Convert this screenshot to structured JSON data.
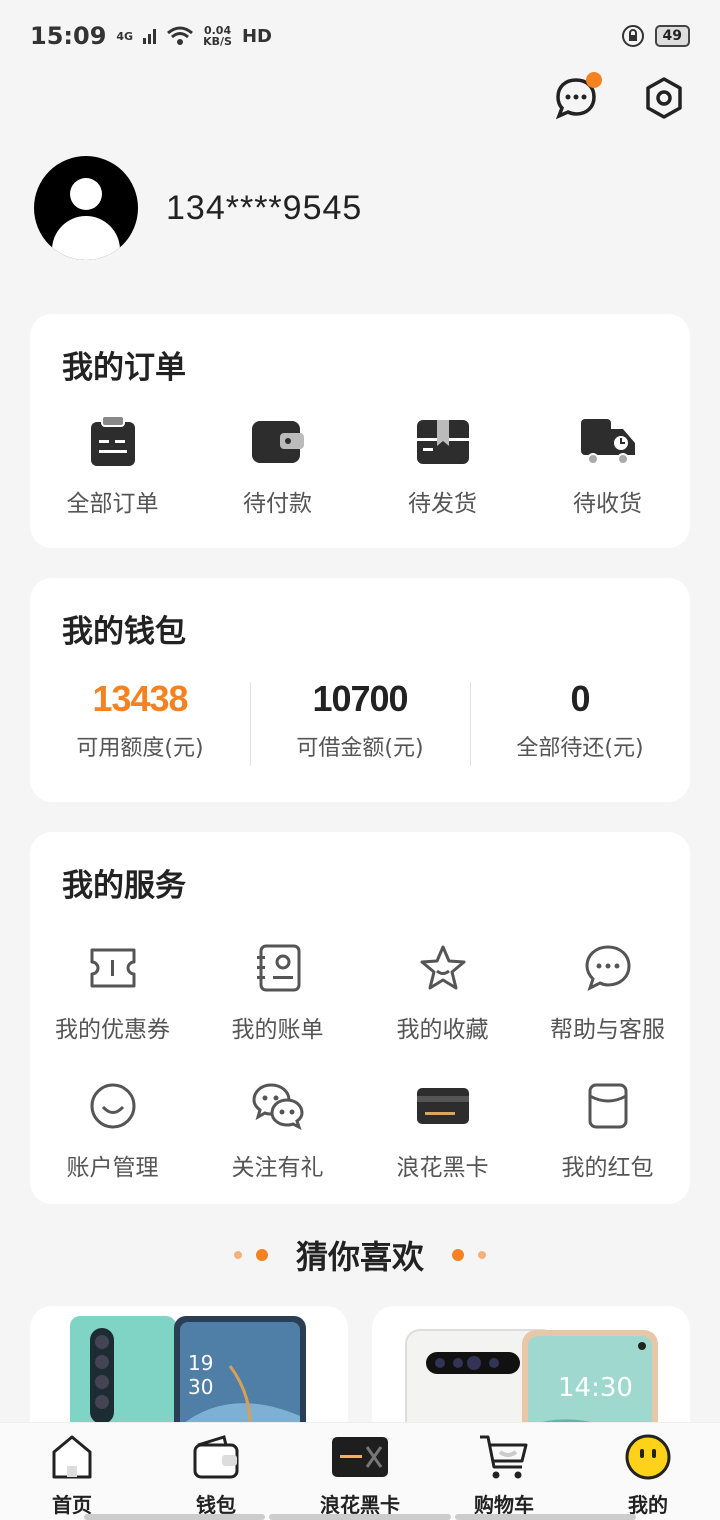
{
  "status_bar": {
    "time": "15:09",
    "network": "4G",
    "speed_value": "0.04",
    "speed_unit": "KB/S",
    "hd": "HD",
    "battery": "49"
  },
  "profile": {
    "phone": "134****9545"
  },
  "orders": {
    "title": "我的订单",
    "items": [
      {
        "label": "全部订单",
        "icon": "clipboard-icon"
      },
      {
        "label": "待付款",
        "icon": "wallet-icon"
      },
      {
        "label": "待发货",
        "icon": "box-icon"
      },
      {
        "label": "待收货",
        "icon": "truck-icon"
      }
    ]
  },
  "wallet": {
    "title": "我的钱包",
    "items": [
      {
        "value": "13438",
        "label": "可用额度(元)"
      },
      {
        "value": "10700",
        "label": "可借金额(元)"
      },
      {
        "value": "0",
        "label": "全部待还(元)"
      }
    ]
  },
  "services": {
    "title": "我的服务",
    "items": [
      {
        "label": "我的优惠券",
        "icon": "coupon-icon"
      },
      {
        "label": "我的账单",
        "icon": "bill-icon"
      },
      {
        "label": "我的收藏",
        "icon": "star-icon"
      },
      {
        "label": "帮助与客服",
        "icon": "chat-icon"
      },
      {
        "label": "账户管理",
        "icon": "smile-icon"
      },
      {
        "label": "关注有礼",
        "icon": "wechat-icon"
      },
      {
        "label": "浪花黑卡",
        "icon": "black-card-icon"
      },
      {
        "label": "我的红包",
        "icon": "red-packet-icon"
      }
    ]
  },
  "guess": {
    "title": "猜你喜欢"
  },
  "tabbar": {
    "items": [
      {
        "label": "首页",
        "icon": "home-icon"
      },
      {
        "label": "钱包",
        "icon": "wallet-tab-icon"
      },
      {
        "label": "浪花黑卡",
        "icon": "black-card-tab-icon"
      },
      {
        "label": "购物车",
        "icon": "cart-icon"
      },
      {
        "label": "我的",
        "icon": "profile-face-icon"
      }
    ]
  },
  "colors": {
    "accent": "#f58220",
    "background": "#f5f5f5"
  }
}
